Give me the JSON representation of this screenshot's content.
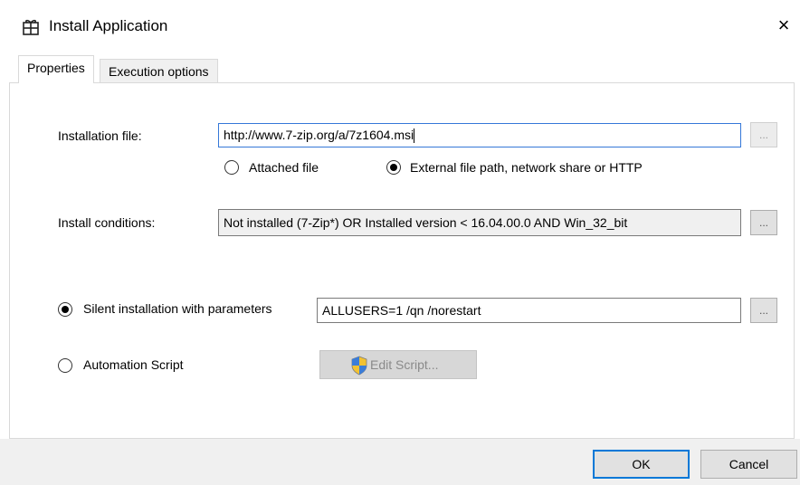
{
  "window": {
    "title": "Install Application",
    "icon": "app-installer-icon",
    "close_glyph": "×"
  },
  "tabs": [
    {
      "label": "Properties",
      "active": true
    },
    {
      "label": "Execution options",
      "active": false
    }
  ],
  "installation_file": {
    "label": "Installation file:",
    "value": "http://www.7-zip.org/a/7z1604.msi",
    "browse_label": "..."
  },
  "file_source": {
    "options": [
      {
        "label": "Attached file",
        "checked": false
      },
      {
        "label": "External file path, network share or HTTP",
        "checked": true
      }
    ]
  },
  "install_conditions": {
    "label": "Install conditions:",
    "value": "Not installed (7-Zip*) OR Installed version < 16.04.00.0 AND Win_32_bit",
    "browse_label": "..."
  },
  "install_mode": {
    "silent": {
      "label": "Silent installation with parameters",
      "checked": true,
      "value": "ALLUSERS=1 /qn /norestart",
      "browse_label": "..."
    },
    "script": {
      "label": "Automation Script",
      "checked": false,
      "edit_label": "Edit Script...",
      "edit_icon": "uac-shield-icon"
    }
  },
  "footer": {
    "ok_label": "OK",
    "cancel_label": "Cancel"
  }
}
